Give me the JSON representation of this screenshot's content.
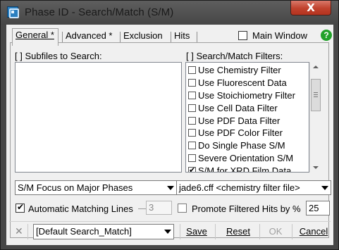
{
  "window": {
    "title": "Phase ID - Search/Match (S/M)",
    "close_label": "X"
  },
  "tabs": [
    {
      "label": "General *",
      "active": true
    },
    {
      "label": "Advanced *",
      "active": false
    },
    {
      "label": "Exclusion",
      "active": false
    },
    {
      "label": "Hits",
      "active": false
    }
  ],
  "main_window_checkbox": {
    "label": "Main Window",
    "checked": false
  },
  "help_label": "?",
  "subfiles": {
    "label": "[ ] Subfiles to Search:"
  },
  "filters": {
    "label": "[ ] Search/Match Filters:",
    "items": [
      {
        "label": "Use Chemistry Filter",
        "checked": false
      },
      {
        "label": "Use Fluorescent Data",
        "checked": false
      },
      {
        "label": "Use Stoichiometry Filter",
        "checked": false
      },
      {
        "label": "Use Cell Data Filter",
        "checked": false
      },
      {
        "label": "Use PDF Data Filter",
        "checked": false
      },
      {
        "label": "Use PDF Color Filter",
        "checked": false
      },
      {
        "label": "Do Single Phase S/M",
        "checked": false
      },
      {
        "label": "Severe Orientation S/M",
        "checked": false
      },
      {
        "label": "S/M for XRD Film Data",
        "checked": true
      }
    ]
  },
  "focus_combo": {
    "value": "S/M Focus on Major Phases"
  },
  "chemistry_combo": {
    "value": "jade6.cff <chemistry filter file>"
  },
  "auto_matching": {
    "label": "Automatic Matching Lines",
    "checked": true,
    "value": "3"
  },
  "promote_hits": {
    "label": "Promote Filtered Hits by %",
    "checked": false,
    "value": "25"
  },
  "bottom": {
    "close_icon": "✕",
    "preset_combo": "[Default Search_Match]",
    "save": "Save",
    "reset": "Reset",
    "ok": "OK",
    "cancel": "Cancel"
  },
  "check_glyph": "✔"
}
